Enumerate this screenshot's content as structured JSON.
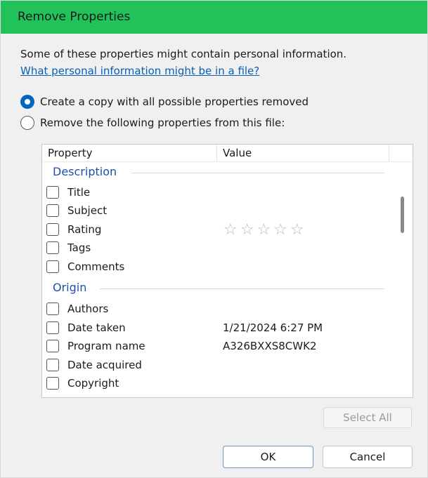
{
  "window": {
    "title": "Remove Properties"
  },
  "intro": {
    "text": "Some of these properties might contain personal information.",
    "link": "What personal information might be in a file?"
  },
  "options": [
    {
      "label": "Create a copy with all possible properties removed",
      "selected": true
    },
    {
      "label": "Remove the following properties from this file:",
      "selected": false
    }
  ],
  "table": {
    "columns": [
      "Property",
      "Value"
    ],
    "groups": [
      {
        "name": "Description",
        "rows": [
          {
            "label": "Title",
            "value": ""
          },
          {
            "label": "Subject",
            "value": ""
          },
          {
            "label": "Rating",
            "value": "☆☆☆☆☆"
          },
          {
            "label": "Tags",
            "value": ""
          },
          {
            "label": "Comments",
            "value": ""
          }
        ]
      },
      {
        "name": "Origin",
        "rows": [
          {
            "label": "Authors",
            "value": ""
          },
          {
            "label": "Date taken",
            "value": "1/21/2024 6:27 PM"
          },
          {
            "label": "Program name",
            "value": "A326BXXS8CWK2"
          },
          {
            "label": "Date acquired",
            "value": ""
          },
          {
            "label": "Copyright",
            "value": ""
          }
        ]
      }
    ]
  },
  "buttons": {
    "select_all": "Select All",
    "ok": "OK",
    "cancel": "Cancel"
  },
  "colors": {
    "titlebar": "#21c25a",
    "link": "#0a5fb4",
    "group_header": "#1f4fa8",
    "radio_selected": "#0067c0"
  }
}
